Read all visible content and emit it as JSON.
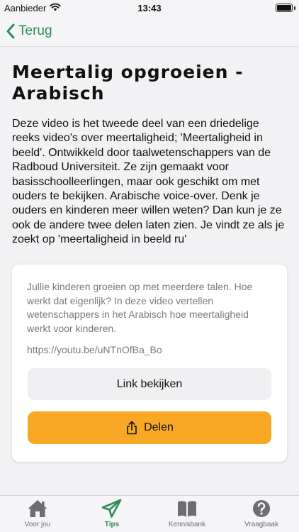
{
  "status_bar": {
    "carrier": "Aanbieder",
    "time": "13:43"
  },
  "nav": {
    "back_label": "Terug"
  },
  "page": {
    "title": "Meertalig opgroeien - Arabisch",
    "description": "Deze video is het tweede deel van een driedelige reeks video's over meertaligheid; 'Meertaligheid in beeld'. Ontwikkeld door taalwetenschappers van de Radboud Universiteit. Ze zijn gemaakt voor basisschoolleerlingen, maar ook geschikt om met ouders te bekijken. Arabische voice-over. Denk je ouders en kinderen meer willen weten? Dan kun je ze ook de andere twee delen laten zien. Je vindt ze als je zoekt op  'meertaligheid in beeld ru'"
  },
  "card": {
    "text": "Jullie kinderen groeien op met meerdere talen. Hoe werkt dat eigenlijk? In deze video vertellen wetenschappers in het Arabisch hoe meertaligheid werkt voor kinderen.",
    "link": "https://youtu.be/uNTnOfBa_Bo",
    "link_button_label": "Link bekijken",
    "share_button_label": "Delen"
  },
  "tabs": [
    {
      "label": "Voor jou",
      "icon": "home-icon",
      "active": false
    },
    {
      "label": "Tips",
      "icon": "paper-plane-icon",
      "active": true
    },
    {
      "label": "Kennisbank",
      "icon": "book-icon",
      "active": false
    },
    {
      "label": "Vraagbaak",
      "icon": "question-circle-icon",
      "active": false
    }
  ],
  "colors": {
    "accent_green": "#2e8b57",
    "share_orange": "#f9a825",
    "inactive_gray": "#6d6d72"
  }
}
